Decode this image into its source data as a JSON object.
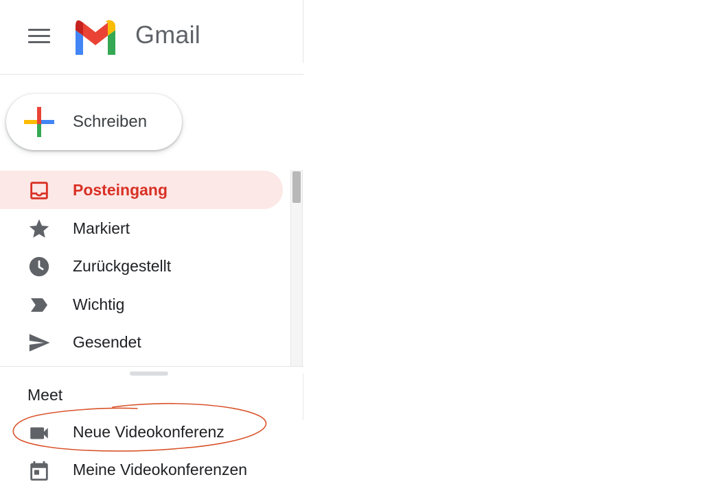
{
  "header": {
    "app_name": "Gmail",
    "menu_icon": "hamburger-menu-icon",
    "logo": "gmail-logo"
  },
  "compose": {
    "label": "Schreiben",
    "icon": "compose-plus-icon"
  },
  "nav": {
    "items": [
      {
        "label": "Posteingang",
        "icon": "inbox-icon",
        "active": true
      },
      {
        "label": "Markiert",
        "icon": "star-icon",
        "active": false
      },
      {
        "label": "Zurückgestellt",
        "icon": "clock-icon",
        "active": false
      },
      {
        "label": "Wichtig",
        "icon": "label-important-icon",
        "active": false
      },
      {
        "label": "Gesendet",
        "icon": "send-icon",
        "active": false
      }
    ]
  },
  "meet": {
    "title": "Meet",
    "items": [
      {
        "label": "Neue Videokonferenz",
        "icon": "videocam-icon"
      },
      {
        "label": "Meine Videokonferenzen",
        "icon": "calendar-icon"
      }
    ]
  },
  "colors": {
    "active_bg": "#fce8e6",
    "active_text": "#d93025",
    "icon_gray": "#5f6368",
    "annotation": "#d9532a",
    "google_blue": "#4285f4",
    "google_red": "#ea4335",
    "google_yellow": "#fbbc04",
    "google_green": "#34a853"
  }
}
